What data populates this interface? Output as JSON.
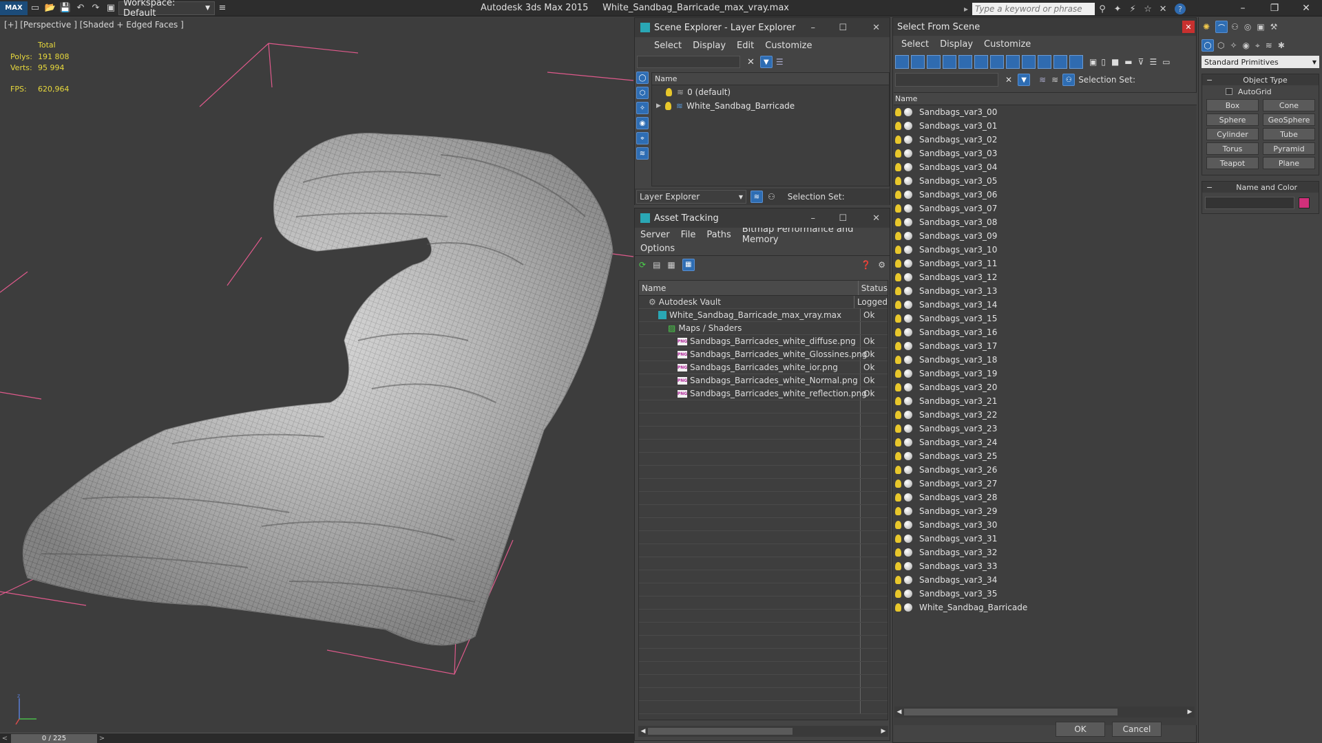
{
  "titlebar": {
    "workspace_label": "Workspace: Default",
    "app_title": "Autodesk 3ds Max  2015",
    "file_title": "White_Sandbag_Barricade_max_vray.max",
    "search_placeholder": "Type a keyword or phrase"
  },
  "viewport": {
    "label": "[+] [Perspective ] [Shaded + Edged Faces ]",
    "total_label": "Total",
    "polys_label": "Polys:",
    "polys_value": "191 808",
    "verts_label": "Verts:",
    "verts_value": "95 994",
    "fps_label": "FPS:",
    "fps_value": "620,964"
  },
  "timeline": {
    "frame": "0 / 225"
  },
  "scene_explorer": {
    "title": "Scene Explorer - Layer Explorer",
    "menu": [
      "Select",
      "Display",
      "Edit",
      "Customize"
    ],
    "column_name": "Name",
    "layers": [
      "0 (default)",
      "White_Sandbag_Barricade"
    ],
    "footer_dropdown": "Layer Explorer",
    "selection_set_label": "Selection Set:"
  },
  "asset_tracking": {
    "title": "Asset Tracking",
    "menu": [
      "Server",
      "File",
      "Paths",
      "Bitmap Performance and Memory",
      "Options"
    ],
    "col_name": "Name",
    "col_status": "Status",
    "rows": [
      {
        "name": "Autodesk Vault",
        "status": "Logged",
        "indent": 0,
        "icon": "vault"
      },
      {
        "name": "White_Sandbag_Barricade_max_vray.max",
        "status": "Ok",
        "indent": 1,
        "icon": "max"
      },
      {
        "name": "Maps / Shaders",
        "status": "",
        "indent": 2,
        "icon": "maps"
      },
      {
        "name": "Sandbags_Barricades_white_diffuse.png",
        "status": "Ok",
        "indent": 3,
        "icon": "png"
      },
      {
        "name": "Sandbags_Barricades_white_Glossines.png",
        "status": "Ok",
        "indent": 3,
        "icon": "png"
      },
      {
        "name": "Sandbags_Barricades_white_ior.png",
        "status": "Ok",
        "indent": 3,
        "icon": "png"
      },
      {
        "name": "Sandbags_Barricades_white_Normal.png",
        "status": "Ok",
        "indent": 3,
        "icon": "png"
      },
      {
        "name": "Sandbags_Barricades_white_reflection.png",
        "status": "Ok",
        "indent": 3,
        "icon": "png"
      }
    ]
  },
  "select_from_scene": {
    "title": "Select From Scene",
    "menu": [
      "Select",
      "Display",
      "Customize"
    ],
    "selection_set_label": "Selection Set:",
    "column_name": "Name",
    "items": [
      "Sandbags_var3_00",
      "Sandbags_var3_01",
      "Sandbags_var3_02",
      "Sandbags_var3_03",
      "Sandbags_var3_04",
      "Sandbags_var3_05",
      "Sandbags_var3_06",
      "Sandbags_var3_07",
      "Sandbags_var3_08",
      "Sandbags_var3_09",
      "Sandbags_var3_10",
      "Sandbags_var3_11",
      "Sandbags_var3_12",
      "Sandbags_var3_13",
      "Sandbags_var3_14",
      "Sandbags_var3_15",
      "Sandbags_var3_16",
      "Sandbags_var3_17",
      "Sandbags_var3_18",
      "Sandbags_var3_19",
      "Sandbags_var3_20",
      "Sandbags_var3_21",
      "Sandbags_var3_22",
      "Sandbags_var3_23",
      "Sandbags_var3_24",
      "Sandbags_var3_25",
      "Sandbags_var3_26",
      "Sandbags_var3_27",
      "Sandbags_var3_28",
      "Sandbags_var3_29",
      "Sandbags_var3_30",
      "Sandbags_var3_31",
      "Sandbags_var3_32",
      "Sandbags_var3_33",
      "Sandbags_var3_34",
      "Sandbags_var3_35",
      "White_Sandbag_Barricade"
    ],
    "ok_label": "OK",
    "cancel_label": "Cancel"
  },
  "command_panel": {
    "dropdown": "Standard Primitives",
    "object_type_label": "Object Type",
    "autogrid_label": "AutoGrid",
    "buttons": [
      "Box",
      "Cone",
      "Sphere",
      "GeoSphere",
      "Cylinder",
      "Tube",
      "Torus",
      "Pyramid",
      "Teapot",
      "Plane"
    ],
    "name_color_label": "Name and Color",
    "color_swatch": "#d0307a"
  },
  "colors": {
    "accent": "#2f6bb0",
    "stats": "#e8d93c",
    "bulb": "#e8c72b"
  }
}
